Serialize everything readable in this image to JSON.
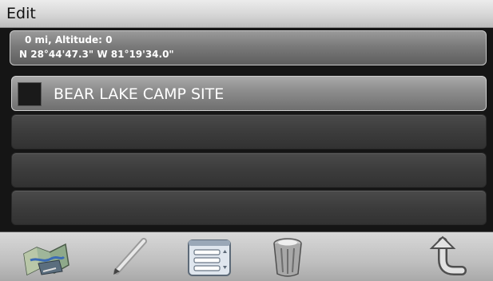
{
  "titlebar": {
    "title": "Edit"
  },
  "location": {
    "distance_altitude": "0 mi, Altitude: 0",
    "coordinates": "N 28°44'47.3\"  W 81°19'34.0\""
  },
  "list": {
    "items": [
      {
        "label": "BEAR LAKE CAMP SITE",
        "selected": true
      },
      {
        "label": ""
      },
      {
        "label": ""
      },
      {
        "label": ""
      }
    ]
  },
  "toolbar": {
    "buttons": [
      {
        "icon": "map-icon"
      },
      {
        "icon": "pencil-icon"
      },
      {
        "icon": "list-menu-icon"
      },
      {
        "icon": "trash-can-icon"
      },
      {
        "icon": "back-arrow-icon"
      }
    ]
  },
  "colors": {
    "titlebar": "#d6d6d6",
    "background": "#151515",
    "selected_row": "#8e8e8e",
    "empty_row": "#3c3c3c",
    "text_light": "#ffffff"
  }
}
